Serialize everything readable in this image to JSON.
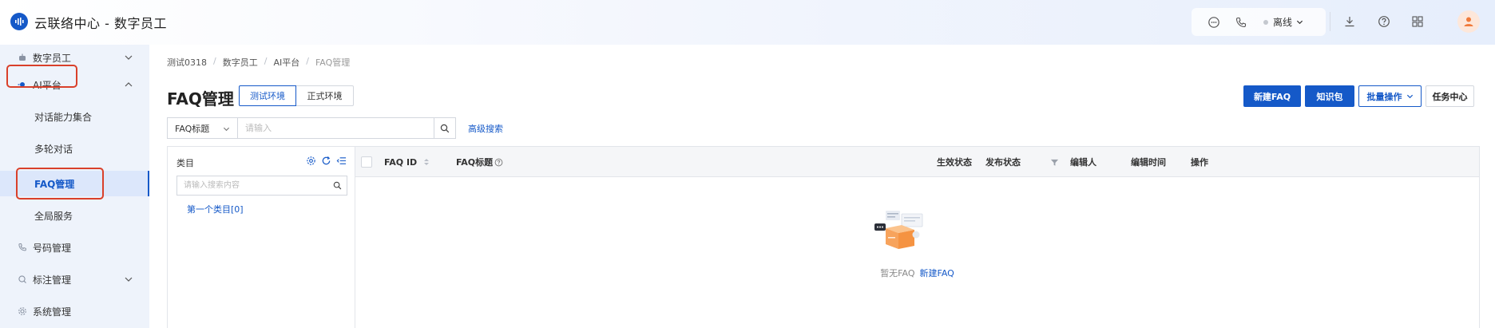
{
  "header": {
    "app_title": "云联络中心 - 数字员工",
    "status": "离线"
  },
  "sidebar": {
    "items": [
      {
        "label": "数字员工",
        "icon": "robot-icon",
        "expandable": true
      },
      {
        "label": "AI平台",
        "icon": "ai-icon",
        "expandable": true,
        "expanded": true
      },
      {
        "label": "对话能力集合"
      },
      {
        "label": "多轮对话"
      },
      {
        "label": "FAQ管理",
        "active": true
      },
      {
        "label": "全局服务"
      },
      {
        "label": "号码管理",
        "icon": "phone-icon"
      },
      {
        "label": "标注管理",
        "icon": "tag-icon",
        "expandable": true
      },
      {
        "label": "系统管理",
        "icon": "settings-icon"
      }
    ]
  },
  "breadcrumb": [
    "测试0318",
    "数字员工",
    "AI平台",
    "FAQ管理"
  ],
  "page": {
    "title": "FAQ管理",
    "env_tabs": [
      "测试环境",
      "正式环境"
    ],
    "active_env": "测试环境"
  },
  "actions": {
    "new_faq": "新建FAQ",
    "knowledge_pack": "知识包",
    "batch_ops": "批量操作",
    "task_center": "任务中心"
  },
  "search": {
    "field": "FAQ标题",
    "placeholder": "请输入",
    "advanced": "高级搜索"
  },
  "category": {
    "title": "类目",
    "search_placeholder": "请输入搜索内容",
    "nodes": [
      "第一个类目[0]"
    ]
  },
  "table": {
    "columns": [
      "FAQ ID",
      "FAQ标题",
      "生效状态",
      "发布状态",
      "编辑人",
      "编辑时间",
      "操作"
    ],
    "rows": [],
    "empty_text": "暂无FAQ",
    "empty_link": "新建FAQ"
  },
  "colors": {
    "primary": "#1559c8",
    "highlight_box": "#d9402a"
  }
}
